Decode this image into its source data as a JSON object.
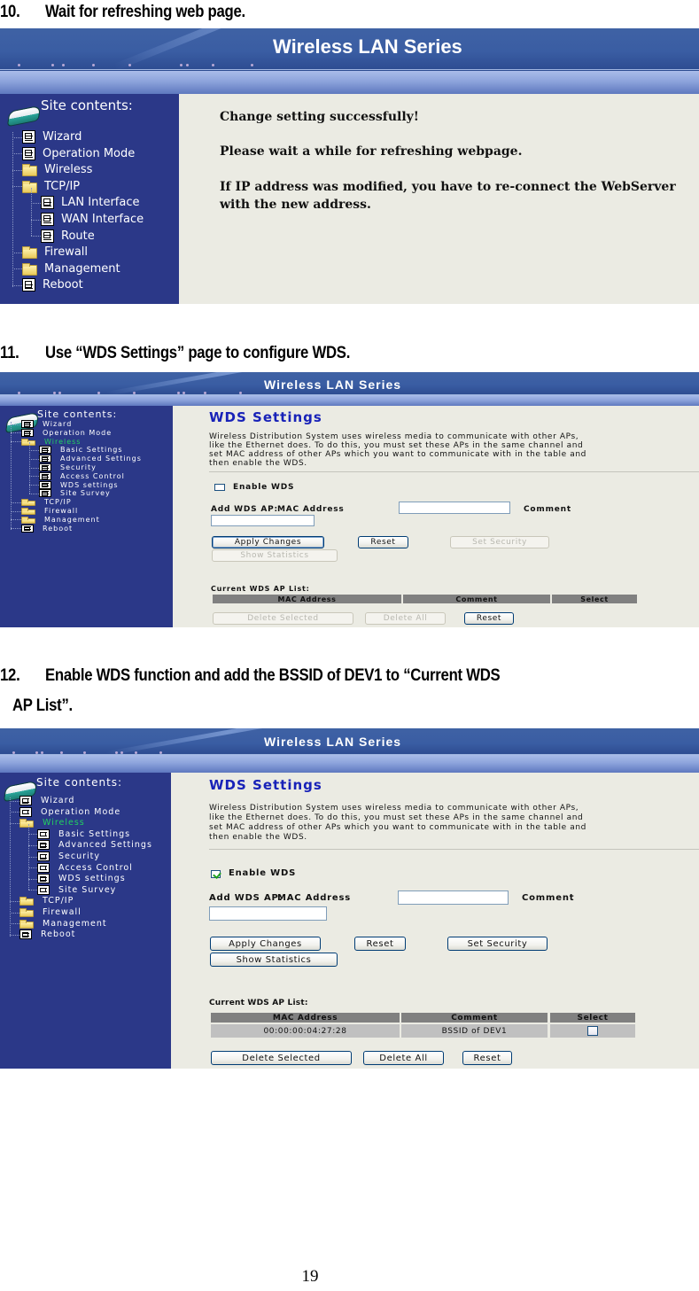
{
  "page": {
    "number": "19"
  },
  "steps": [
    {
      "number": "10.",
      "text": "Wait for refreshing web page.",
      "screenshot": {
        "banner_title": "Wireless LAN Series",
        "sidebar": {
          "root_label": "Site contents:",
          "items": [
            {
              "label": "Wizard",
              "icon": "document-icon",
              "level": 1
            },
            {
              "label": "Operation Mode",
              "icon": "document-icon",
              "level": 1
            },
            {
              "label": "Wireless",
              "icon": "folder-icon",
              "level": 1
            },
            {
              "label": "TCP/IP",
              "icon": "folder-open-icon",
              "level": 1
            },
            {
              "label": "LAN Interface",
              "icon": "document-icon",
              "level": 2
            },
            {
              "label": "WAN Interface",
              "icon": "document-icon",
              "level": 2
            },
            {
              "label": "Route",
              "icon": "document-icon",
              "level": 2
            },
            {
              "label": "Firewall",
              "icon": "folder-icon",
              "level": 1
            },
            {
              "label": "Management",
              "icon": "folder-icon",
              "level": 1
            },
            {
              "label": "Reboot",
              "icon": "document-icon",
              "level": 1
            }
          ]
        },
        "messages": [
          "Change setting successfully!",
          "Please wait a while for refreshing webpage.",
          "If IP address was modified, you have to re-connect the WebServer",
          "with the new address."
        ]
      }
    },
    {
      "number": "11.",
      "text": "Use “WDS Settings” page to configure WDS.",
      "screenshot": {
        "banner_title": "Wireless LAN Series",
        "sidebar": {
          "root_label": "Site contents:",
          "items": [
            {
              "label": "Wizard",
              "icon": "document-icon",
              "level": 1
            },
            {
              "label": "Operation Mode",
              "icon": "document-icon",
              "level": 1
            },
            {
              "label": "Wireless",
              "icon": "folder-open-icon",
              "level": 1,
              "active": true
            },
            {
              "label": "Basic Settings",
              "icon": "document-icon",
              "level": 2
            },
            {
              "label": "Advanced Settings",
              "icon": "document-icon",
              "level": 2
            },
            {
              "label": "Security",
              "icon": "document-icon",
              "level": 2
            },
            {
              "label": "Access Control",
              "icon": "document-icon",
              "level": 2
            },
            {
              "label": "WDS settings",
              "icon": "document-icon",
              "level": 2
            },
            {
              "label": "Site Survey",
              "icon": "document-icon",
              "level": 2
            },
            {
              "label": "TCP/IP",
              "icon": "folder-icon",
              "level": 1
            },
            {
              "label": "Firewall",
              "icon": "folder-icon",
              "level": 1
            },
            {
              "label": "Management",
              "icon": "folder-icon",
              "level": 1
            },
            {
              "label": "Reboot",
              "icon": "document-icon",
              "level": 1
            }
          ]
        },
        "wds": {
          "title": "WDS Settings",
          "description": [
            "Wireless Distribution System uses wireless media to communicate with other APs,",
            "like the Ethernet does. To do this, you must set these APs in the same channel and",
            "set MAC address of other APs which you want to communicate with in the table and",
            "then enable the WDS."
          ],
          "enable_label": "Enable WDS",
          "enable_checked": false,
          "add_label": "Add WDS AP:",
          "mac_label": "MAC Address",
          "mac_value": "",
          "comment_label": "Comment",
          "comment_value": "",
          "buttons": {
            "apply": {
              "label": "Apply Changes",
              "enabled": true
            },
            "reset": {
              "label": "Reset",
              "enabled": true
            },
            "set_security": {
              "label": "Set Security",
              "enabled": false
            },
            "show_statistics": {
              "label": "Show Statistics",
              "enabled": false
            }
          },
          "list_label": "Current WDS AP List:",
          "columns": [
            "MAC Address",
            "Comment",
            "Select"
          ],
          "rows": [],
          "list_buttons": {
            "delete_selected": {
              "label": "Delete Selected",
              "enabled": false
            },
            "delete_all": {
              "label": "Delete All",
              "enabled": false
            },
            "reset": {
              "label": "Reset",
              "enabled": true
            }
          }
        }
      }
    },
    {
      "number": "12.",
      "text": "Enable WDS function and add the BSSID of DEV1 to “Current WDS",
      "text_line2": "AP List”.",
      "screenshot": {
        "banner_title": "Wireless LAN Series",
        "sidebar": {
          "root_label": "Site contents:",
          "items": [
            {
              "label": "Wizard",
              "icon": "document-icon",
              "level": 1
            },
            {
              "label": "Operation Mode",
              "icon": "document-icon",
              "level": 1
            },
            {
              "label": "Wireless",
              "icon": "folder-open-icon",
              "level": 1,
              "active": true
            },
            {
              "label": "Basic Settings",
              "icon": "document-icon",
              "level": 2
            },
            {
              "label": "Advanced Settings",
              "icon": "document-icon",
              "level": 2
            },
            {
              "label": "Security",
              "icon": "document-icon",
              "level": 2
            },
            {
              "label": "Access Control",
              "icon": "document-icon",
              "level": 2
            },
            {
              "label": "WDS settings",
              "icon": "document-icon",
              "level": 2
            },
            {
              "label": "Site Survey",
              "icon": "document-icon",
              "level": 2
            },
            {
              "label": "TCP/IP",
              "icon": "folder-icon",
              "level": 1
            },
            {
              "label": "Firewall",
              "icon": "folder-icon",
              "level": 1
            },
            {
              "label": "Management",
              "icon": "folder-icon",
              "level": 1
            },
            {
              "label": "Reboot",
              "icon": "document-icon",
              "level": 1
            }
          ]
        },
        "wds": {
          "title": "WDS Settings",
          "description": [
            "Wireless Distribution System uses wireless media to communicate with other APs,",
            "like the Ethernet does. To do this, you must set these APs in the same channel and",
            "set MAC address of other APs which you want to communicate with in the table and",
            "then enable the WDS."
          ],
          "enable_label": "Enable WDS",
          "enable_checked": true,
          "add_label": "Add WDS AP:",
          "mac_label": "MAC Address",
          "mac_value": "",
          "comment_label": "Comment",
          "comment_value": "",
          "buttons": {
            "apply": {
              "label": "Apply Changes",
              "enabled": true
            },
            "reset": {
              "label": "Reset",
              "enabled": true
            },
            "set_security": {
              "label": "Set Security",
              "enabled": true
            },
            "show_statistics": {
              "label": "Show Statistics",
              "enabled": true
            }
          },
          "list_label": "Current WDS AP List:",
          "columns": [
            "MAC Address",
            "Comment",
            "Select"
          ],
          "rows": [
            {
              "mac": "00:00:00:04:27:28",
              "comment": "BSSID of DEV1",
              "selected": false
            }
          ],
          "list_buttons": {
            "delete_selected": {
              "label": "Delete Selected",
              "enabled": true
            },
            "delete_all": {
              "label": "Delete All",
              "enabled": true
            },
            "reset": {
              "label": "Reset",
              "enabled": true
            }
          }
        }
      }
    }
  ]
}
